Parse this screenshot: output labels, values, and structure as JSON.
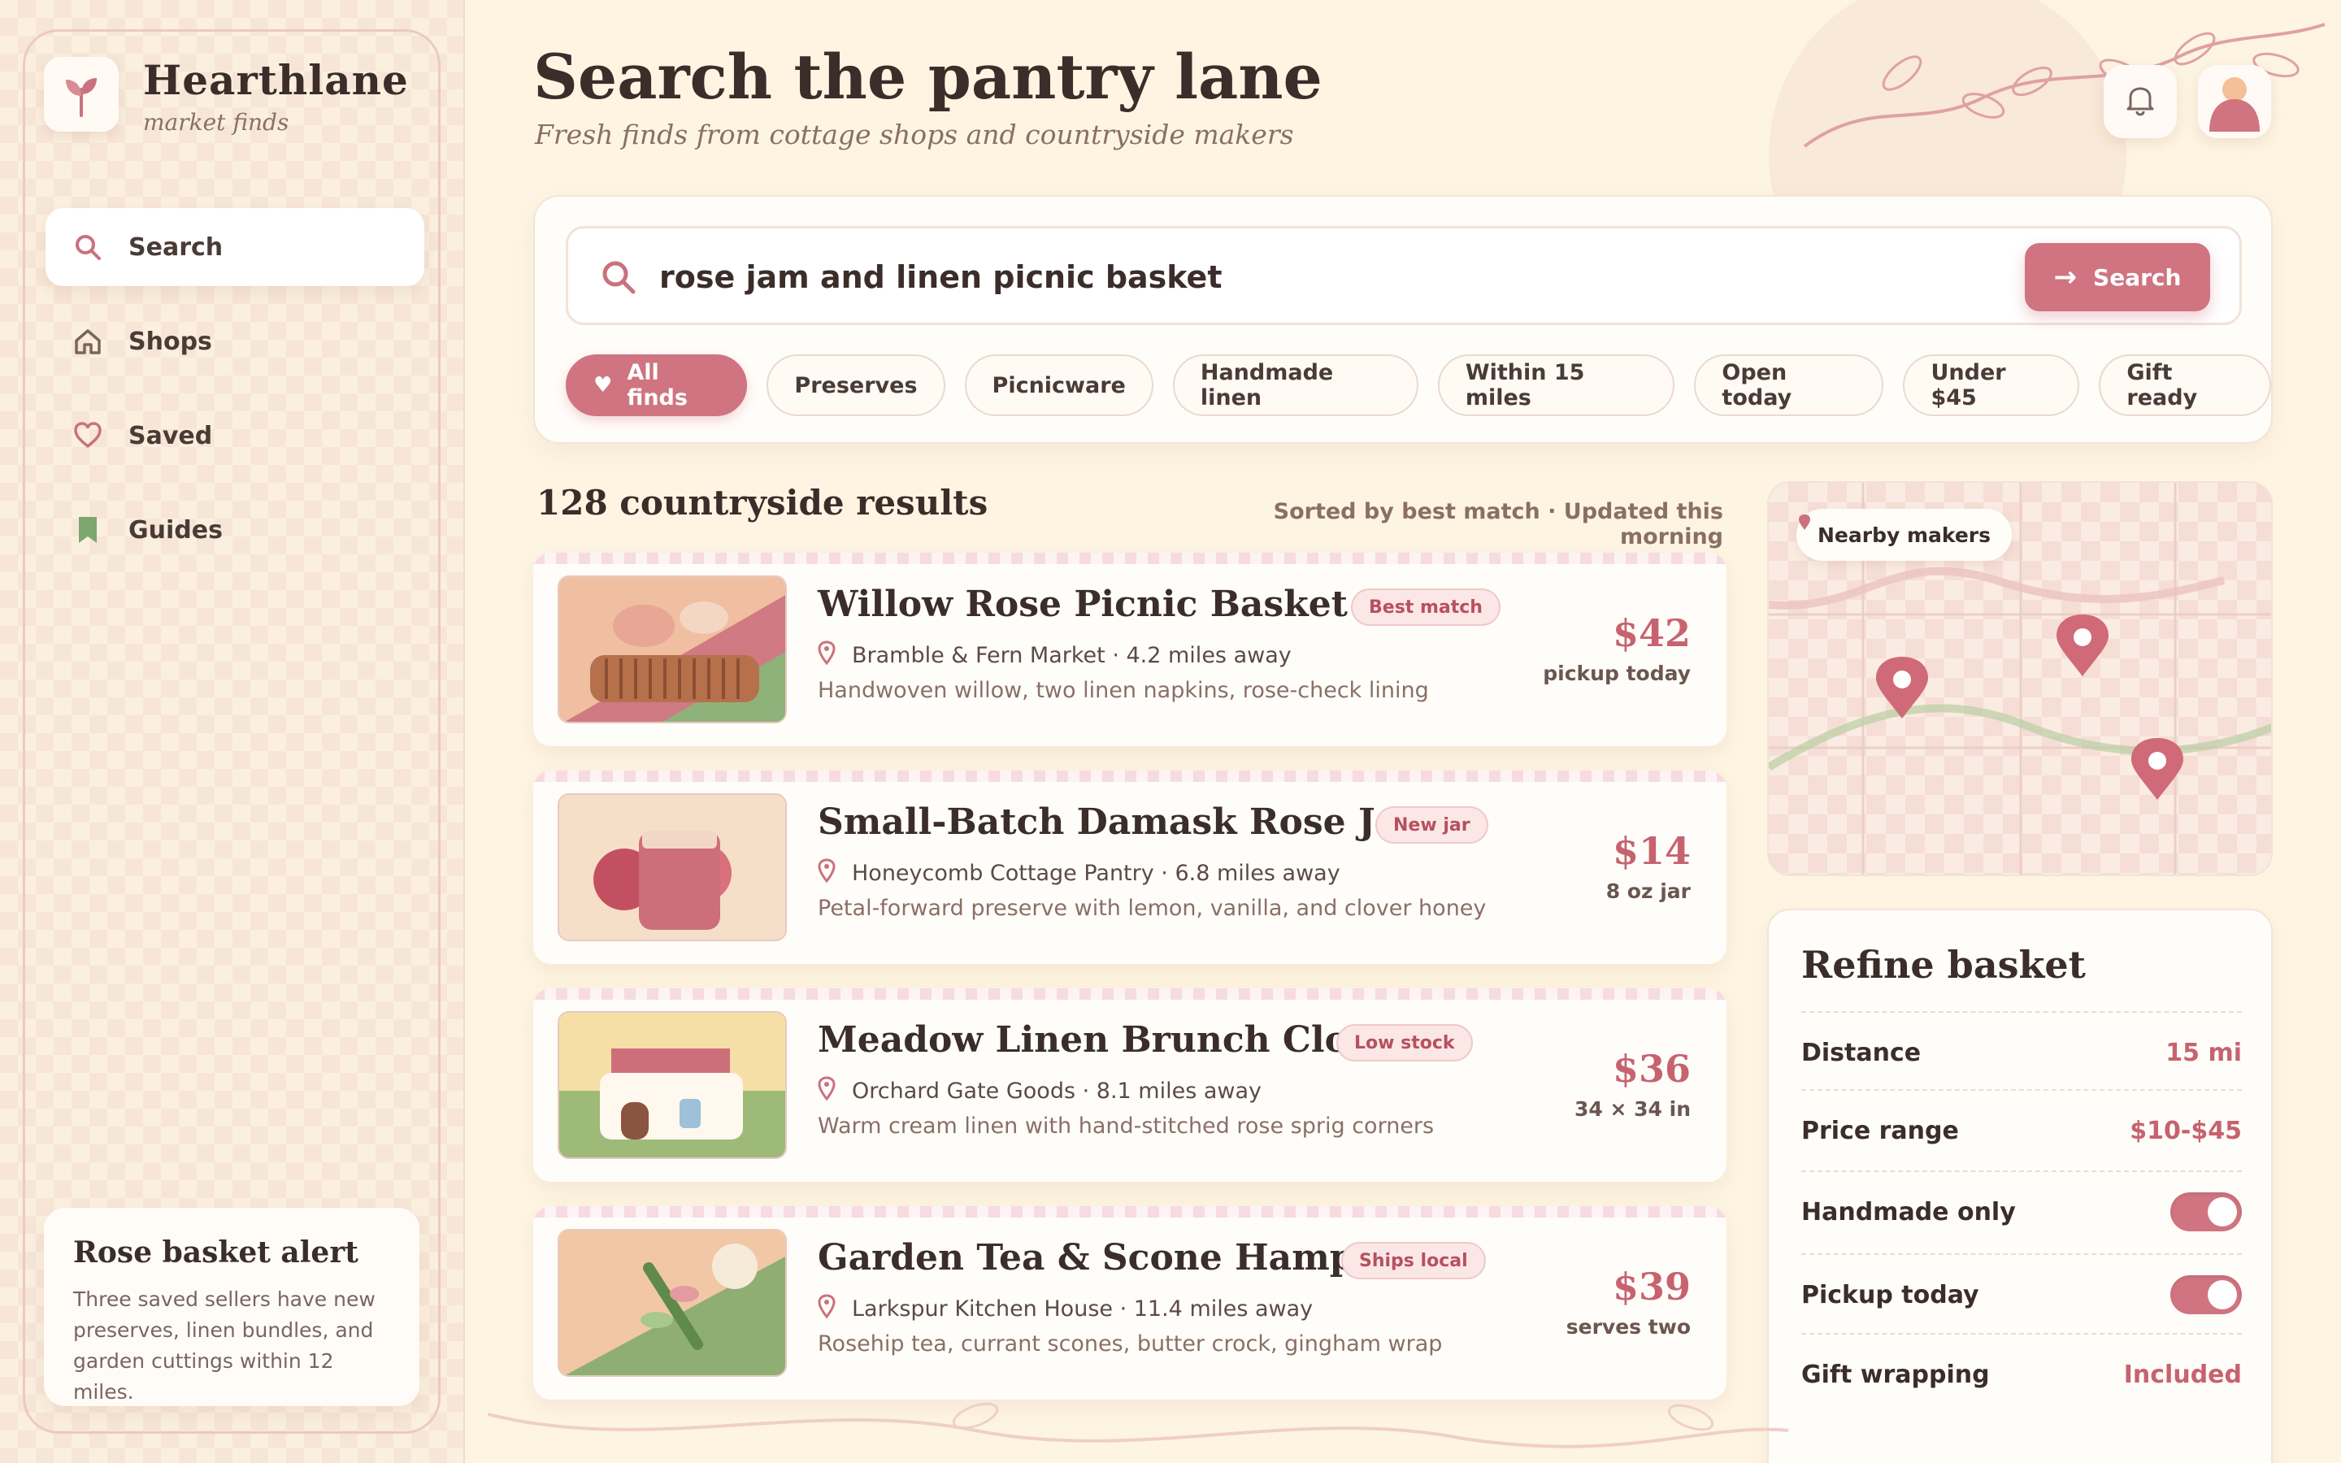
{
  "brand": {
    "name": "Hearthlane",
    "tagline": "market finds"
  },
  "nav": {
    "items": [
      {
        "label": "Search",
        "icon": "search-icon",
        "active": true
      },
      {
        "label": "Shops",
        "icon": "home-icon",
        "active": false
      },
      {
        "label": "Saved",
        "icon": "heart-icon",
        "active": false
      },
      {
        "label": "Guides",
        "icon": "bookmark-icon",
        "active": false
      }
    ]
  },
  "alert": {
    "title": "Rose basket alert",
    "body": "Three saved sellers have new preserves, linen bundles, and garden cuttings within 12 miles."
  },
  "header": {
    "title": "Search the pantry lane",
    "subtitle": "Fresh finds from cottage shops and countryside makers",
    "icons": [
      "bell-icon",
      "avatar"
    ]
  },
  "search": {
    "value": "rose jam and linen picnic basket",
    "placeholder": "",
    "button_label": "Search"
  },
  "chips": [
    {
      "label": "All finds",
      "active": true
    },
    {
      "label": "Preserves",
      "active": false
    },
    {
      "label": "Picnicware",
      "active": false
    },
    {
      "label": "Handmade linen",
      "active": false
    },
    {
      "label": "Within 15 miles",
      "active": false
    },
    {
      "label": "Open today",
      "active": false
    },
    {
      "label": "Under $45",
      "active": false
    },
    {
      "label": "Gift ready",
      "active": false
    }
  ],
  "results": {
    "count_label": "128 countryside results",
    "sort_label": "Sorted by best match · Updated this morning",
    "items": [
      {
        "title": "Willow Rose Picnic Basket ...",
        "badge": "Best match",
        "location": "Bramble & Fern Market · 4.2 miles away",
        "description": "Handwoven willow, two linen napkins, rose-check lining",
        "price": "$42",
        "note": "pickup today"
      },
      {
        "title": "Small-Batch Damask Rose Jam",
        "badge": "New jar",
        "location": "Honeycomb Cottage Pantry · 6.8 miles away",
        "description": "Petal-forward preserve with lemon, vanilla, and clover honey",
        "price": "$14",
        "note": "8 oz jar"
      },
      {
        "title": "Meadow Linen Brunch Cloth",
        "badge": "Low stock",
        "location": "Orchard Gate Goods · 8.1 miles away",
        "description": "Warm cream linen with hand-stitched rose sprig corners",
        "price": "$36",
        "note": "34 × 34 in"
      },
      {
        "title": "Garden Tea & Scone Hamper",
        "badge": "Ships local",
        "location": "Larkspur Kitchen House · 11.4 miles away",
        "description": "Rosehip tea, currant scones, butter crock, gingham wrap",
        "price": "$39",
        "note": "serves two"
      }
    ]
  },
  "map": {
    "label": "Nearby makers"
  },
  "refine": {
    "title": "Refine basket",
    "rows": [
      {
        "label": "Distance",
        "value": "15 mi"
      },
      {
        "label": "Price range",
        "value": "$10-$45"
      },
      {
        "label": "Handmade only",
        "toggle": true
      },
      {
        "label": "Pickup today",
        "toggle": true
      },
      {
        "label": "Gift wrapping",
        "value": "Included"
      }
    ]
  },
  "colors": {
    "accent": "#cf7480",
    "accent_text": "#c7626f",
    "background": "#fdf5e2",
    "heading": "#3b2d2a"
  }
}
